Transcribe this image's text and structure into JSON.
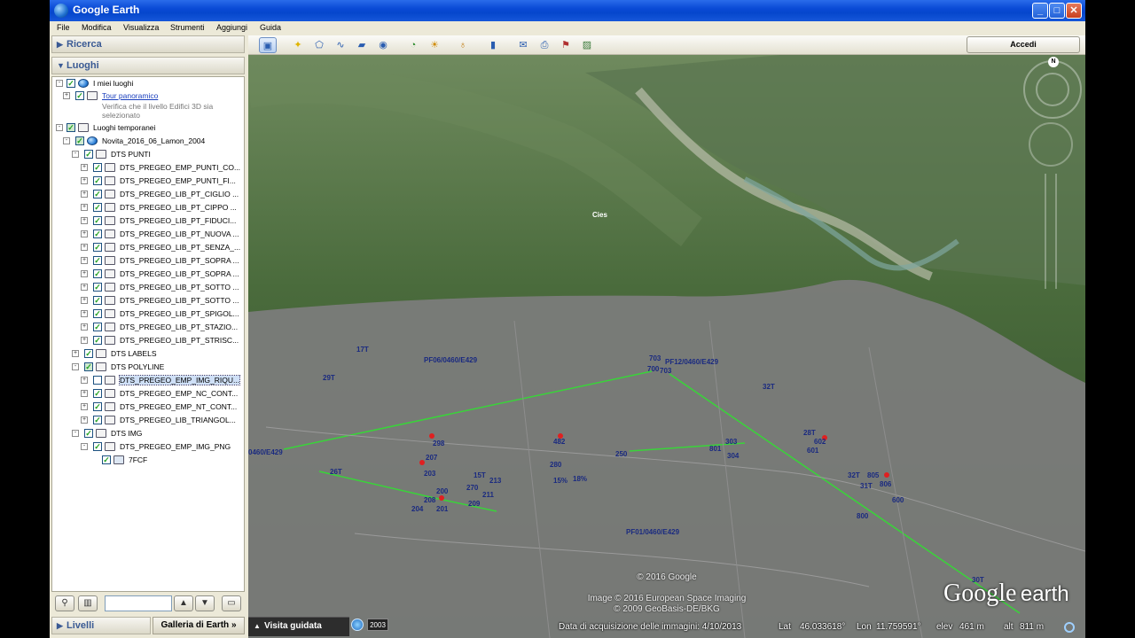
{
  "window": {
    "title": "Google Earth",
    "controls": [
      "_",
      "□",
      "✕"
    ]
  },
  "menu": [
    "File",
    "Modifica",
    "Visualizza",
    "Strumenti",
    "Aggiungi",
    "Guida"
  ],
  "sidebar": {
    "search_header": "Ricerca",
    "places_header": "Luoghi",
    "layers_header": "Livelli",
    "gallery_button": "Galleria di Earth",
    "gallery_arrow": "»",
    "tree": [
      {
        "label": "I miei luoghi",
        "checked": true
      },
      {
        "label": "Tour panoramico",
        "checked": true,
        "link": true
      },
      {
        "label": "Verifica che il livello Edifici 3D sia selezionato",
        "note": true
      },
      {
        "label": "Luoghi temporanei",
        "checked": true
      },
      {
        "label": "Novita_2016_06_Lamon_2004",
        "checked": true
      },
      {
        "label": "DTS PUNTI",
        "checked": true
      },
      {
        "label": "DTS_PREGEO_EMP_PUNTI_CO...",
        "checked": true
      },
      {
        "label": "DTS_PREGEO_EMP_PUNTI_FI...",
        "checked": true
      },
      {
        "label": "DTS_PREGEO_LIB_PT_CIGLIO ...",
        "checked": true
      },
      {
        "label": "DTS_PREGEO_LIB_PT_CIPPO ...",
        "checked": true
      },
      {
        "label": "DTS_PREGEO_LIB_PT_FIDUCI...",
        "checked": true
      },
      {
        "label": "DTS_PREGEO_LIB_PT_NUOVA ...",
        "checked": true
      },
      {
        "label": "DTS_PREGEO_LIB_PT_SENZA_...",
        "checked": true
      },
      {
        "label": "DTS_PREGEO_LIB_PT_SOPRA ...",
        "checked": true
      },
      {
        "label": "DTS_PREGEO_LIB_PT_SOPRA ...",
        "checked": true
      },
      {
        "label": "DTS_PREGEO_LIB_PT_SOTTO ...",
        "checked": true
      },
      {
        "label": "DTS_PREGEO_LIB_PT_SOTTO ...",
        "checked": true
      },
      {
        "label": "DTS_PREGEO_LIB_PT_SPIGOL...",
        "checked": true
      },
      {
        "label": "DTS_PREGEO_LIB_PT_STAZIO...",
        "checked": true
      },
      {
        "label": "DTS_PREGEO_LIB_PT_STRISC...",
        "checked": true
      },
      {
        "label": "DTS LABELS",
        "checked": true
      },
      {
        "label": "DTS POLYLINE",
        "checked": true
      },
      {
        "label": "DTS_PREGEO_EMP_IMG_RIQU...",
        "checked": false,
        "selected": true
      },
      {
        "label": "DTS_PREGEO_EMP_NC_CONT...",
        "checked": true
      },
      {
        "label": "DTS_PREGEO_EMP_NT_CONT...",
        "checked": true
      },
      {
        "label": "DTS_PREGEO_LIB_TRIANGOL...",
        "checked": true
      },
      {
        "label": "DTS IMG",
        "checked": true
      },
      {
        "label": "DTS_PREGEO_EMP_IMG_PNG",
        "checked": true
      },
      {
        "label": "7FCF",
        "checked": true
      }
    ]
  },
  "toolbar": {
    "icons": [
      "sidebar-toggle-icon",
      "placemark-icon",
      "polygon-icon",
      "path-icon",
      "overlay-icon",
      "tour-icon",
      "history-icon",
      "sun-icon",
      "planets-icon",
      "ruler-icon",
      "email-icon",
      "print-icon",
      "maps-icon",
      "save-image-icon"
    ],
    "signin_label": "Accedi"
  },
  "map": {
    "place_label": "Cies",
    "point_labels": [
      "PF06/0460/E429",
      "PF12/0460/E429",
      "PF01/0460/E429",
      "0460/E429",
      "17T",
      "29T",
      "32T",
      "26T",
      "28T",
      "32T",
      "31T",
      "30T",
      "703",
      "703",
      "700",
      "298",
      "207",
      "203",
      "200",
      "208",
      "201",
      "204",
      "209",
      "270",
      "211",
      "213",
      "15T",
      "482",
      "280",
      "15%",
      "18%",
      "801",
      "303",
      "304",
      "805",
      "806",
      "800",
      "600",
      "601",
      "602",
      "250"
    ],
    "credit_1": "© 2016 Google",
    "credit_2": "Image © 2016 European Space Imaging",
    "credit_3": "© 2009 GeoBasis-DE/BKG",
    "logo_google": "Google",
    "logo_earth": "earth",
    "compass_north": "N"
  },
  "status": {
    "tour_button": "Visita guidata",
    "year": "2003",
    "imagery_date": "Data di acquisizione delle immagini: 4/10/2013",
    "lat_label": "Lat",
    "lat": "46.033618°",
    "lon_label": "Lon",
    "lon": "11.759591°",
    "elev_label": "elev",
    "elev": "461 m",
    "alt_label": "alt",
    "alt": "811 m"
  }
}
